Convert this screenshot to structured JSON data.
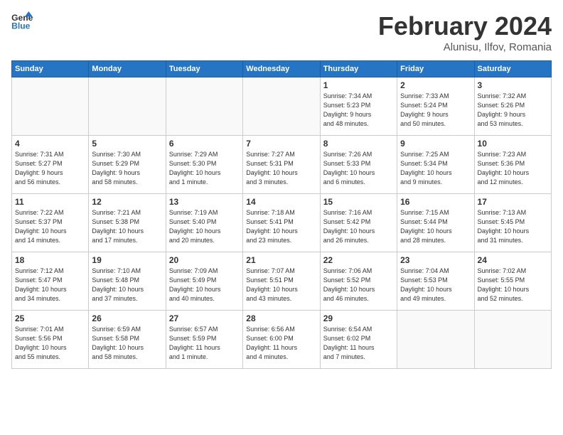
{
  "header": {
    "logo_line1": "General",
    "logo_line2": "Blue",
    "month_title": "February 2024",
    "location": "Alunisu, Ilfov, Romania"
  },
  "days_of_week": [
    "Sunday",
    "Monday",
    "Tuesday",
    "Wednesday",
    "Thursday",
    "Friday",
    "Saturday"
  ],
  "weeks": [
    [
      {
        "day": "",
        "info": ""
      },
      {
        "day": "",
        "info": ""
      },
      {
        "day": "",
        "info": ""
      },
      {
        "day": "",
        "info": ""
      },
      {
        "day": "1",
        "info": "Sunrise: 7:34 AM\nSunset: 5:23 PM\nDaylight: 9 hours\nand 48 minutes."
      },
      {
        "day": "2",
        "info": "Sunrise: 7:33 AM\nSunset: 5:24 PM\nDaylight: 9 hours\nand 50 minutes."
      },
      {
        "day": "3",
        "info": "Sunrise: 7:32 AM\nSunset: 5:26 PM\nDaylight: 9 hours\nand 53 minutes."
      }
    ],
    [
      {
        "day": "4",
        "info": "Sunrise: 7:31 AM\nSunset: 5:27 PM\nDaylight: 9 hours\nand 56 minutes."
      },
      {
        "day": "5",
        "info": "Sunrise: 7:30 AM\nSunset: 5:29 PM\nDaylight: 9 hours\nand 58 minutes."
      },
      {
        "day": "6",
        "info": "Sunrise: 7:29 AM\nSunset: 5:30 PM\nDaylight: 10 hours\nand 1 minute."
      },
      {
        "day": "7",
        "info": "Sunrise: 7:27 AM\nSunset: 5:31 PM\nDaylight: 10 hours\nand 3 minutes."
      },
      {
        "day": "8",
        "info": "Sunrise: 7:26 AM\nSunset: 5:33 PM\nDaylight: 10 hours\nand 6 minutes."
      },
      {
        "day": "9",
        "info": "Sunrise: 7:25 AM\nSunset: 5:34 PM\nDaylight: 10 hours\nand 9 minutes."
      },
      {
        "day": "10",
        "info": "Sunrise: 7:23 AM\nSunset: 5:36 PM\nDaylight: 10 hours\nand 12 minutes."
      }
    ],
    [
      {
        "day": "11",
        "info": "Sunrise: 7:22 AM\nSunset: 5:37 PM\nDaylight: 10 hours\nand 14 minutes."
      },
      {
        "day": "12",
        "info": "Sunrise: 7:21 AM\nSunset: 5:38 PM\nDaylight: 10 hours\nand 17 minutes."
      },
      {
        "day": "13",
        "info": "Sunrise: 7:19 AM\nSunset: 5:40 PM\nDaylight: 10 hours\nand 20 minutes."
      },
      {
        "day": "14",
        "info": "Sunrise: 7:18 AM\nSunset: 5:41 PM\nDaylight: 10 hours\nand 23 minutes."
      },
      {
        "day": "15",
        "info": "Sunrise: 7:16 AM\nSunset: 5:42 PM\nDaylight: 10 hours\nand 26 minutes."
      },
      {
        "day": "16",
        "info": "Sunrise: 7:15 AM\nSunset: 5:44 PM\nDaylight: 10 hours\nand 28 minutes."
      },
      {
        "day": "17",
        "info": "Sunrise: 7:13 AM\nSunset: 5:45 PM\nDaylight: 10 hours\nand 31 minutes."
      }
    ],
    [
      {
        "day": "18",
        "info": "Sunrise: 7:12 AM\nSunset: 5:47 PM\nDaylight: 10 hours\nand 34 minutes."
      },
      {
        "day": "19",
        "info": "Sunrise: 7:10 AM\nSunset: 5:48 PM\nDaylight: 10 hours\nand 37 minutes."
      },
      {
        "day": "20",
        "info": "Sunrise: 7:09 AM\nSunset: 5:49 PM\nDaylight: 10 hours\nand 40 minutes."
      },
      {
        "day": "21",
        "info": "Sunrise: 7:07 AM\nSunset: 5:51 PM\nDaylight: 10 hours\nand 43 minutes."
      },
      {
        "day": "22",
        "info": "Sunrise: 7:06 AM\nSunset: 5:52 PM\nDaylight: 10 hours\nand 46 minutes."
      },
      {
        "day": "23",
        "info": "Sunrise: 7:04 AM\nSunset: 5:53 PM\nDaylight: 10 hours\nand 49 minutes."
      },
      {
        "day": "24",
        "info": "Sunrise: 7:02 AM\nSunset: 5:55 PM\nDaylight: 10 hours\nand 52 minutes."
      }
    ],
    [
      {
        "day": "25",
        "info": "Sunrise: 7:01 AM\nSunset: 5:56 PM\nDaylight: 10 hours\nand 55 minutes."
      },
      {
        "day": "26",
        "info": "Sunrise: 6:59 AM\nSunset: 5:58 PM\nDaylight: 10 hours\nand 58 minutes."
      },
      {
        "day": "27",
        "info": "Sunrise: 6:57 AM\nSunset: 5:59 PM\nDaylight: 11 hours\nand 1 minute."
      },
      {
        "day": "28",
        "info": "Sunrise: 6:56 AM\nSunset: 6:00 PM\nDaylight: 11 hours\nand 4 minutes."
      },
      {
        "day": "29",
        "info": "Sunrise: 6:54 AM\nSunset: 6:02 PM\nDaylight: 11 hours\nand 7 minutes."
      },
      {
        "day": "",
        "info": ""
      },
      {
        "day": "",
        "info": ""
      }
    ]
  ]
}
